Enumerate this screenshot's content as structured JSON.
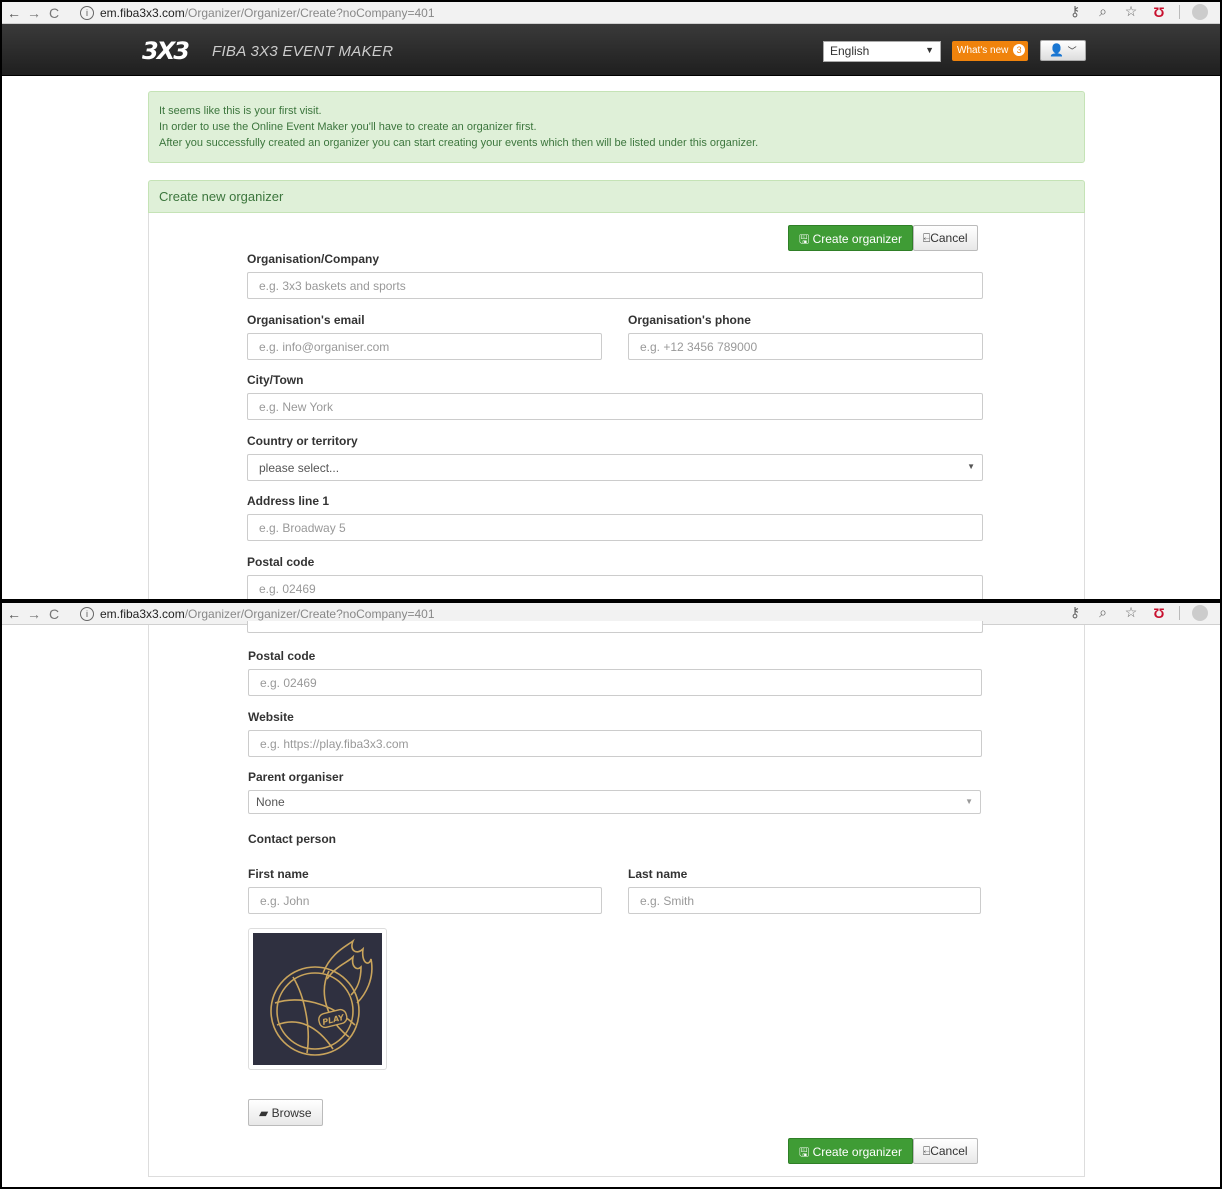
{
  "browser": {
    "url_host": "em.fiba3x3.com",
    "url_path": "/Organizer/Organizer/Create?noCompany=401"
  },
  "header": {
    "logo": "3X3",
    "brand": "FIBA 3X3 EVENT MAKER",
    "language": "English",
    "whats_new": "What's new",
    "whats_new_count": "3"
  },
  "alert": {
    "line1": "It seems like this is your first visit.",
    "line2": "In order to use the Online Event Maker you'll have to create an organizer first.",
    "line3": "After you successfully created an organizer you can start creating your events which then will be listed under this organizer."
  },
  "panel": {
    "title": "Create new organizer"
  },
  "buttons": {
    "create": "Create organizer",
    "cancel": "Cancel",
    "browse": "Browse"
  },
  "form": {
    "org_label": "Organisation/Company",
    "org_placeholder": "e.g. 3x3 baskets and sports",
    "email_label": "Organisation's email",
    "email_placeholder": "e.g. info@organiser.com",
    "phone_label": "Organisation's phone",
    "phone_placeholder": "e.g. +12 3456 789000",
    "city_label": "City/Town",
    "city_placeholder": "e.g. New York",
    "country_label": "Country or territory",
    "country_value": "please select...",
    "address_label": "Address line 1",
    "address_placeholder": "e.g. Broadway 5",
    "postal_label": "Postal code",
    "postal_placeholder": "e.g. 02469",
    "website_label": "Website",
    "website_placeholder": "e.g. https://play.fiba3x3.com",
    "parent_label": "Parent organiser",
    "parent_value": "None",
    "contact_heading": "Contact person",
    "first_label": "First name",
    "first_placeholder": "e.g. John",
    "last_label": "Last name",
    "last_placeholder": "e.g. Smith",
    "logo_text": "PLAY"
  },
  "colors": {
    "primary_green": "#3f9c35",
    "alert_bg": "#dff0d8",
    "alert_text": "#3c763d",
    "orange": "#f0830c",
    "logo_bg": "#2f3040",
    "logo_gold": "#c9a45c"
  }
}
